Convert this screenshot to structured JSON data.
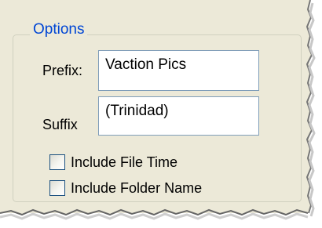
{
  "options_group": {
    "title": "Options",
    "prefix_label": "Prefix:",
    "prefix_value": "Vaction Pics",
    "suffix_label": "Suffix",
    "suffix_value": "(Trinidad)",
    "checkboxes": [
      {
        "label": "Include File Time",
        "checked": false
      },
      {
        "label": "Include Folder Name",
        "checked": false
      }
    ]
  },
  "colors": {
    "panel_bg": "#ece9d8",
    "legend_text": "#0046d5",
    "textbox_border": "#7f9db9",
    "checkbox_border": "#1c5180"
  }
}
